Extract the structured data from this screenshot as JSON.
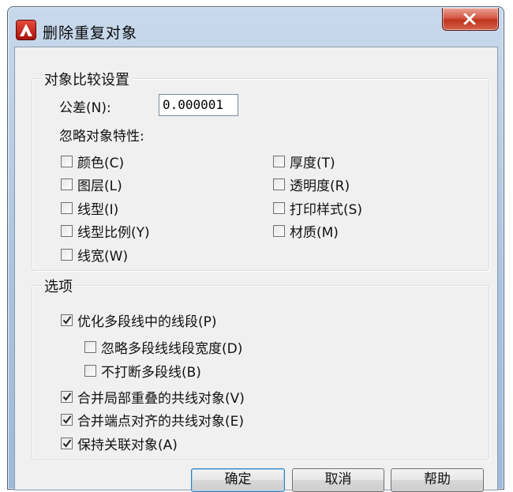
{
  "window": {
    "title": "删除重复对象"
  },
  "compare_group": {
    "title": "对象比较设置",
    "tolerance_label": "公差(N):",
    "tolerance_value": "0.000001",
    "ignore_label": "忽略对象特性:",
    "left_options": [
      {
        "label": "颜色(C)",
        "checked": false
      },
      {
        "label": "图层(L)",
        "checked": false
      },
      {
        "label": "线型(I)",
        "checked": false
      },
      {
        "label": "线型比例(Y)",
        "checked": false
      },
      {
        "label": "线宽(W)",
        "checked": false
      }
    ],
    "right_options": [
      {
        "label": "厚度(T)",
        "checked": false
      },
      {
        "label": "透明度(R)",
        "checked": false
      },
      {
        "label": "打印样式(S)",
        "checked": false
      },
      {
        "label": "材质(M)",
        "checked": false
      }
    ]
  },
  "options_group": {
    "title": "选项",
    "items": [
      {
        "label": "优化多段线中的线段(P)",
        "checked": true
      },
      {
        "label": "忽略多段线线段宽度(D)",
        "checked": false
      },
      {
        "label": "不打断多段线(B)",
        "checked": false
      },
      {
        "label": "合并局部重叠的共线对象(V)",
        "checked": true
      },
      {
        "label": "合并端点对齐的共线对象(E)",
        "checked": true
      },
      {
        "label": "保持关联对象(A)",
        "checked": true
      }
    ]
  },
  "buttons": {
    "ok": "确定",
    "cancel": "取消",
    "help": "帮助"
  }
}
